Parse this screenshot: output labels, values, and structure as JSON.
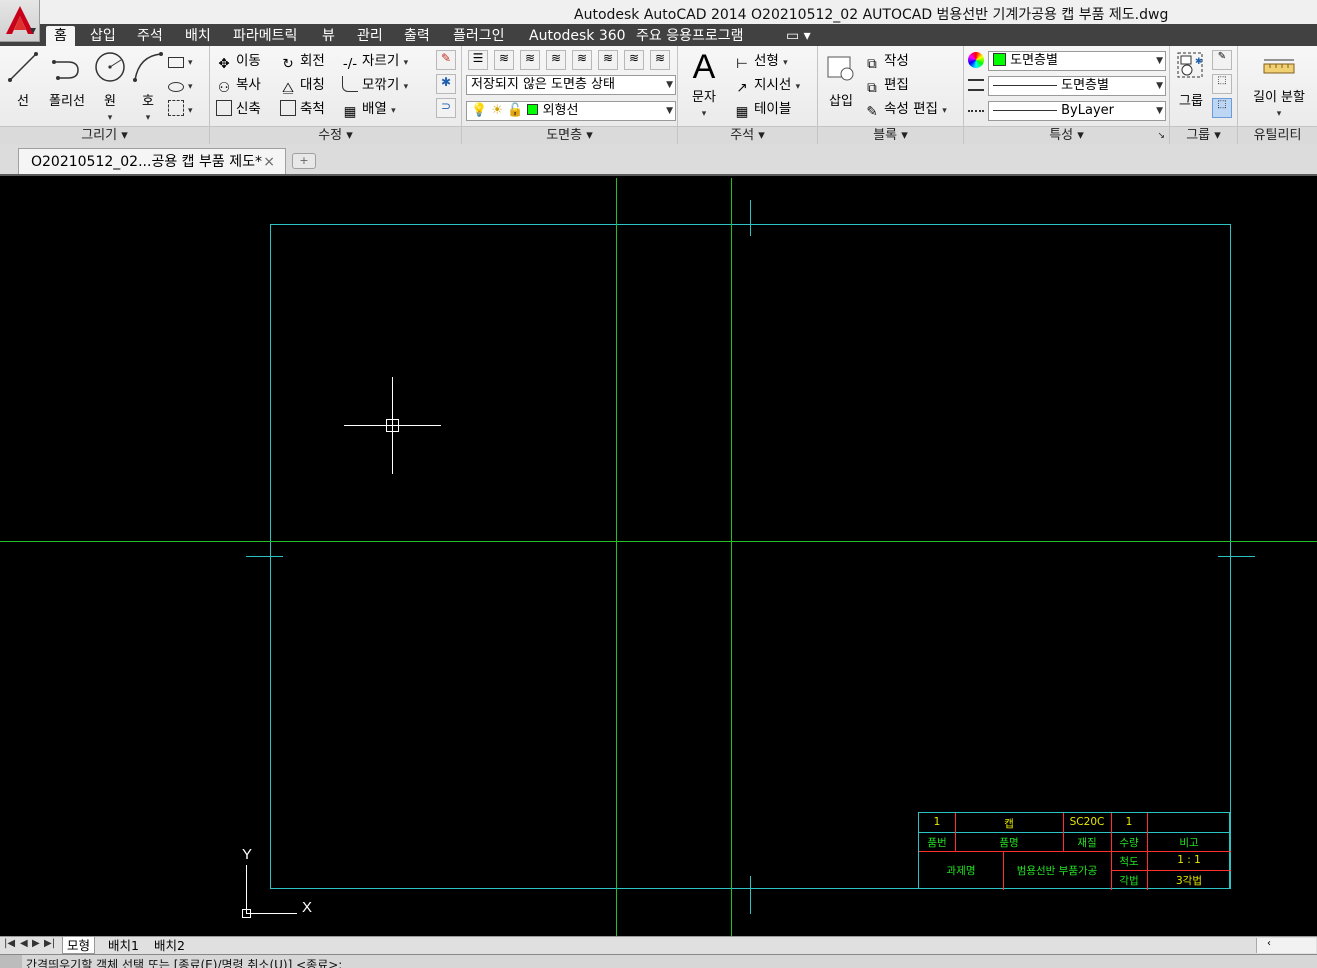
{
  "window": {
    "title": "Autodesk AutoCAD 2014     O20210512_02 AUTOCAD 범용선반 기계가공용 캡 부품 제도.dwg"
  },
  "ribbon_tabs": [
    {
      "label": "홈",
      "active": true
    },
    {
      "label": "삽입"
    },
    {
      "label": "주석"
    },
    {
      "label": "배치"
    },
    {
      "label": "파라메트릭"
    },
    {
      "label": "뷰"
    },
    {
      "label": "관리"
    },
    {
      "label": "출력"
    },
    {
      "label": "플러그인"
    },
    {
      "label": "Autodesk 360"
    },
    {
      "label": "주요 응용프로그램"
    }
  ],
  "panels": {
    "draw": {
      "title": "그리기",
      "line": "선",
      "polyline": "폴리선",
      "circle": "원",
      "arc": "호"
    },
    "modify": {
      "title": "수정",
      "move": "이동",
      "rotate": "회전",
      "trim": "자르기",
      "copy": "복사",
      "mirror": "대칭",
      "fillet": "모깎기",
      "stretch": "신축",
      "scale": "축척",
      "array": "배열"
    },
    "layers": {
      "title": "도면층",
      "state": "저장되지 않은 도면층 상태",
      "current_layer": "외형선",
      "layer_color": "#00ff00"
    },
    "annotation": {
      "title": "주석",
      "text": "문자",
      "linear": "선형",
      "leader": "지시선",
      "table": "테이블"
    },
    "block": {
      "title": "블록",
      "insert": "삽입",
      "create": "작성",
      "edit": "편집",
      "edit_attributes": "속성 편집"
    },
    "properties": {
      "title": "특성",
      "color": "도면층별",
      "linetype": "도면층별",
      "lineweight": "ByLayer"
    },
    "groups": {
      "title": "그룹",
      "group": "그룹"
    },
    "utilities": {
      "title": "유틸리티",
      "measure": "길이 분할"
    }
  },
  "file_tab": {
    "name": "O20210512_02...공용 캡 부품 제도*",
    "close": "×"
  },
  "ucs": {
    "x": "X",
    "y": "Y"
  },
  "title_block": {
    "row1": {
      "no": "1",
      "name": "캡",
      "material": "SC20C",
      "qty": "1"
    },
    "row2": {
      "no": "품번",
      "name": "품명",
      "material": "재질",
      "qty": "수량",
      "remark": "비고"
    },
    "project_label": "과제명",
    "project_name": "범용선반 부품가공",
    "scale_label": "척도",
    "scale_value": "1 : 1",
    "projection_label": "각법",
    "projection_value": "3각법"
  },
  "layout_tabs": [
    {
      "label": "모형",
      "active": true
    },
    {
      "label": "배치1"
    },
    {
      "label": "배치2"
    }
  ],
  "command_line": "간격띄우기할 객체 선택 또는 [종료(E)/명령 취소(U)] <종료>:",
  "colors": {
    "border_cyan": "#2ac4c4",
    "centerline_green": "#22c022",
    "crosshair": "#ffffff",
    "tb_yellow": "#e8e800",
    "tb_green": "#22e022",
    "tb_red": "#ff3030"
  }
}
